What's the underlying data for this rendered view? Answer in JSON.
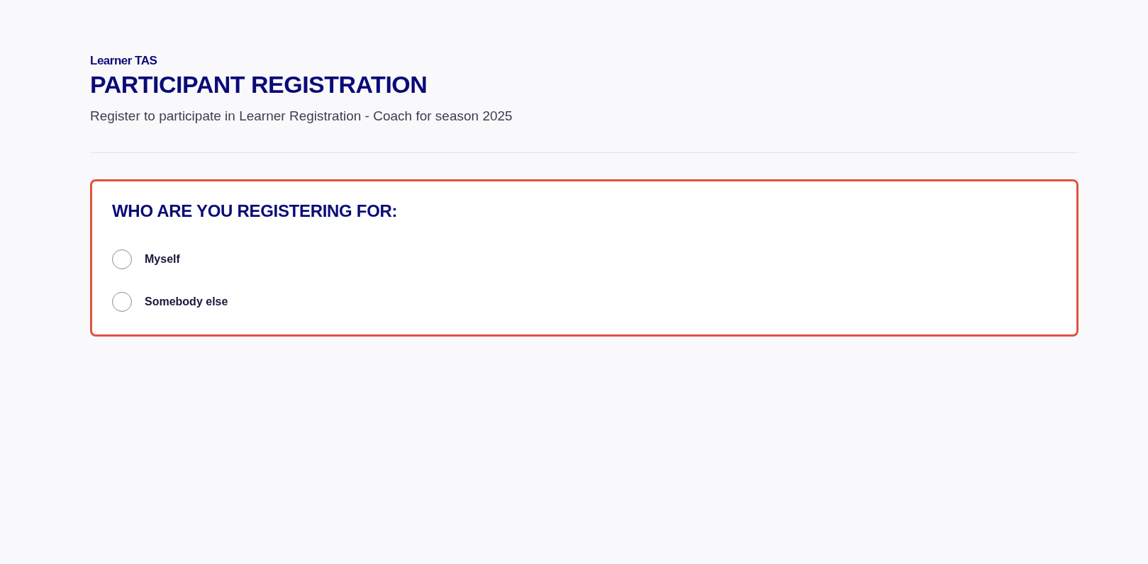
{
  "header": {
    "organization": "Learner TAS",
    "title": "PARTICIPANT REGISTRATION",
    "subtitle": "Register to participate in Learner Registration - Coach for season 2025"
  },
  "question": {
    "title": "WHO ARE YOU REGISTERING FOR:",
    "error": true,
    "options": [
      {
        "label": "Myself",
        "selected": false
      },
      {
        "label": "Somebody else",
        "selected": false
      }
    ]
  }
}
